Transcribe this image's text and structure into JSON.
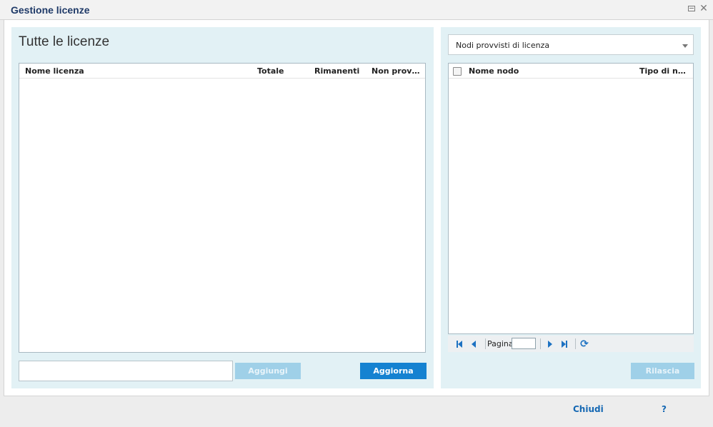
{
  "window": {
    "title": "Gestione licenze"
  },
  "left_panel": {
    "title": "Tutte le licenze",
    "columns": [
      "Nome licenza",
      "Totale",
      "Rimanenti",
      "Non prov…"
    ],
    "rows": [],
    "filter_value": "",
    "add_label": "Aggiungi",
    "refresh_label": "Aggiorna"
  },
  "right_panel": {
    "dropdown_value": "Nodi provvisti di licenza",
    "columns": [
      "Nome nodo",
      "Tipo di n…"
    ],
    "rows": [],
    "pager": {
      "page_label": "Pagina",
      "page_value": ""
    },
    "release_label": "Rilascia"
  },
  "footer": {
    "close_label": "Chiudi",
    "help_label": "?"
  },
  "colors": {
    "primary_button": "#1582d1",
    "disabled_button": "#9fd0e8",
    "panel_background": "#e2f1f5",
    "title_color": "#1f3a68",
    "link_color": "#1568b3"
  },
  "icons": {
    "window_restore": "restore-icon",
    "window_close": "close-icon",
    "pager_first": "first-page-icon",
    "pager_prev": "previous-page-icon",
    "pager_next": "next-page-icon",
    "pager_last": "last-page-icon",
    "pager_refresh": "refresh-icon"
  }
}
